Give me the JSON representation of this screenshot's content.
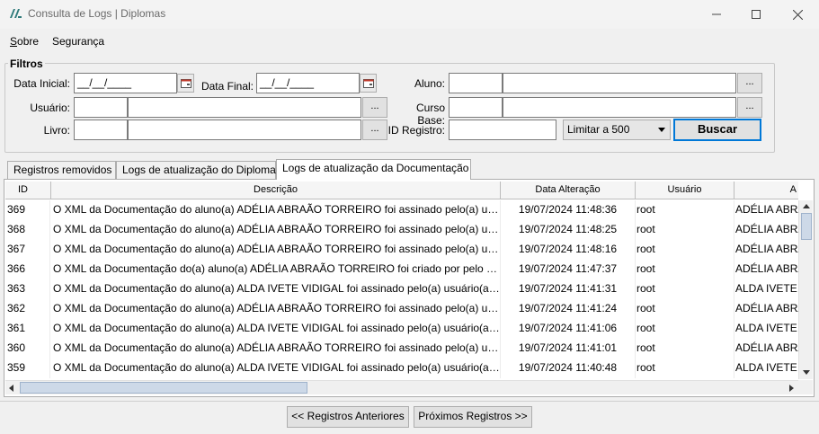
{
  "window": {
    "title": "Consulta de Logs | Diplomas",
    "app_icon": "app-logo-icon"
  },
  "menu": {
    "sobre": "Sobre",
    "seguranca": "Segurança"
  },
  "filters": {
    "legend": "Filtros",
    "data_inicial_label": "Data Inicial:",
    "data_inicial_value": "__/__/____",
    "data_final_label": "Data Final:",
    "data_final_value": "__/__/____",
    "aluno_label": "Aluno:",
    "usuario_label": "Usuário:",
    "curso_base_label": "Curso Base:",
    "livro_label": "Livro:",
    "id_registro_label": "ID Registro:",
    "lookup_button": "...",
    "limit_select": "Limitar a 500",
    "buscar": "Buscar"
  },
  "tabs": [
    {
      "label": "Registros removidos",
      "active": false
    },
    {
      "label": "Logs de atualização do Diploma",
      "active": false
    },
    {
      "label": "Logs de atualização da Documentação",
      "active": true
    }
  ],
  "table": {
    "columns": [
      "ID",
      "Descrição",
      "Data Alteração",
      "Usuário",
      "A"
    ],
    "rows": [
      {
        "id": "369",
        "desc": "O XML da Documentação do aluno(a) ADÉLIA ABRAÃO TORREIRO foi assinado pelo(a) usuár...",
        "date": "19/07/2024 11:48:36",
        "user": "root",
        "aluno": "ADÉLIA ABRA"
      },
      {
        "id": "368",
        "desc": "O XML da Documentação do aluno(a) ADÉLIA ABRAÃO TORREIRO foi assinado pelo(a) usuár...",
        "date": "19/07/2024 11:48:25",
        "user": "root",
        "aluno": "ADÉLIA ABRA"
      },
      {
        "id": "367",
        "desc": "O XML da Documentação do aluno(a) ADÉLIA ABRAÃO TORREIRO foi assinado pelo(a) usuár...",
        "date": "19/07/2024 11:48:16",
        "user": "root",
        "aluno": "ADÉLIA ABRA"
      },
      {
        "id": "366",
        "desc": "O XML da Documentação do(a) aluno(a) ADÉLIA ABRAÃO TORREIRO foi criado por pelo usu...",
        "date": "19/07/2024 11:47:37",
        "user": "root",
        "aluno": "ADÉLIA ABRA"
      },
      {
        "id": "363",
        "desc": "O XML da Documentação do aluno(a) ALDA IVETE VIDIGAL foi assinado pelo(a) usuário(a) R...",
        "date": "19/07/2024 11:41:31",
        "user": "root",
        "aluno": "ALDA IVETE V"
      },
      {
        "id": "362",
        "desc": "O XML da Documentação do aluno(a) ADÉLIA ABRAÃO TORREIRO foi assinado pelo(a) usuár...",
        "date": "19/07/2024 11:41:24",
        "user": "root",
        "aluno": "ADÉLIA ABRA"
      },
      {
        "id": "361",
        "desc": "O XML da Documentação do aluno(a) ALDA IVETE VIDIGAL foi assinado pelo(a) usuário(a) R...",
        "date": "19/07/2024 11:41:06",
        "user": "root",
        "aluno": "ALDA IVETE V"
      },
      {
        "id": "360",
        "desc": "O XML da Documentação do aluno(a) ADÉLIA ABRAÃO TORREIRO foi assinado pelo(a) usuár...",
        "date": "19/07/2024 11:41:01",
        "user": "root",
        "aluno": "ADÉLIA ABRA"
      },
      {
        "id": "359",
        "desc": "O XML da Documentação do aluno(a) ALDA IVETE VIDIGAL foi assinado pelo(a) usuário(a) R...",
        "date": "19/07/2024 11:40:48",
        "user": "root",
        "aluno": "ALDA IVETE V"
      }
    ]
  },
  "footer": {
    "prev": "<< Registros Anteriores",
    "next": "Próximos Registros >>"
  },
  "colors": {
    "accent": "#0078d7",
    "window_bg": "#f0f0f0",
    "scroll_thumb": "#cdd9e8"
  }
}
